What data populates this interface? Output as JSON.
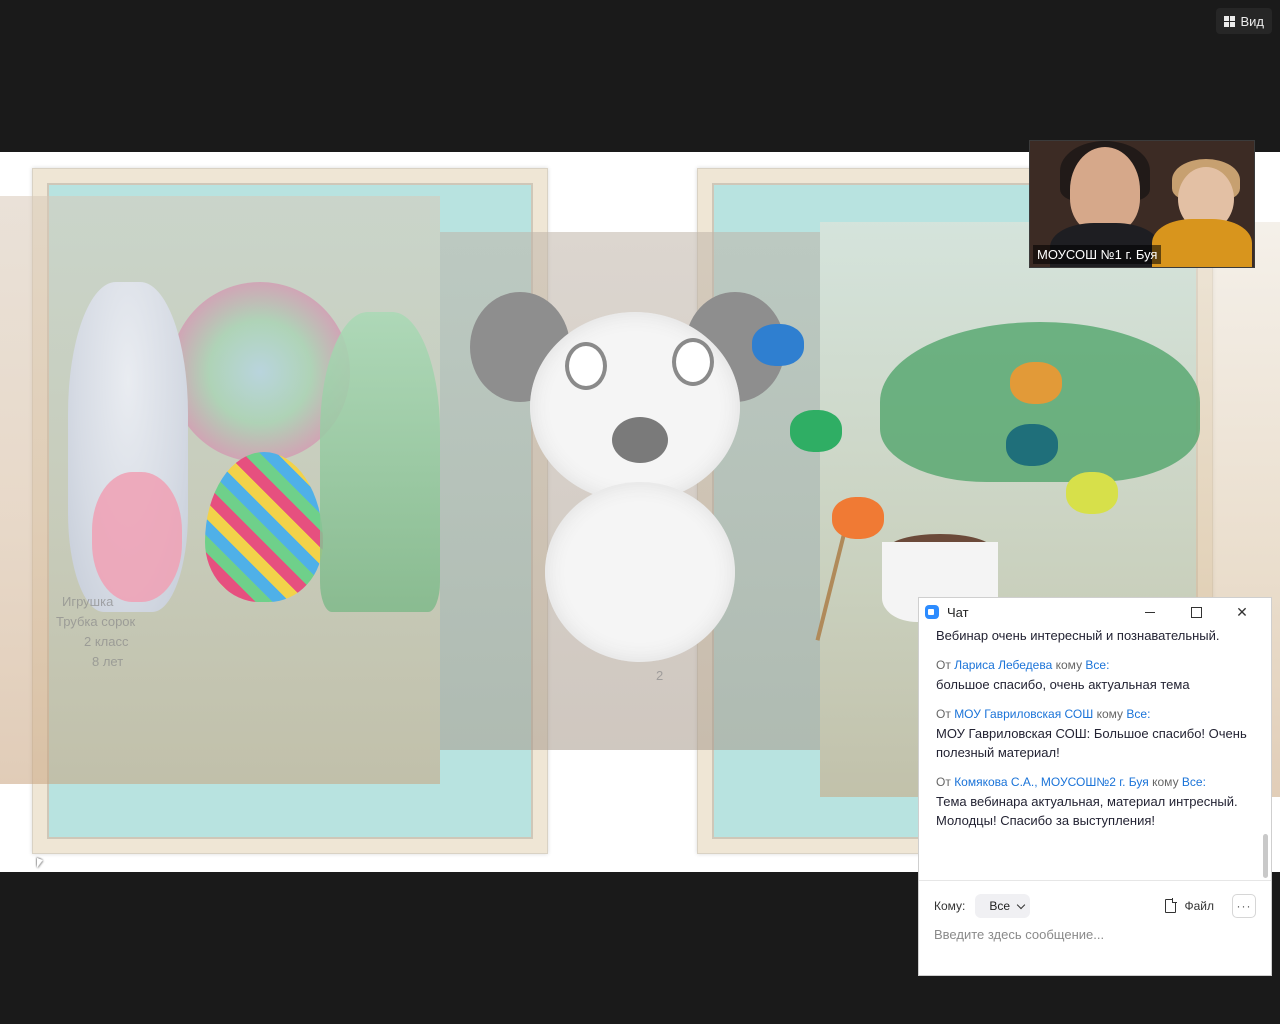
{
  "toolbar": {
    "view_label": "Вид",
    "view_icon": "grid-icon"
  },
  "shared_screen": {
    "captions": {
      "left_line1": "Игрушка",
      "left_line2": "Трубка сорок",
      "left_line3": "2 класс",
      "left_line4": "8 лет",
      "mid_number": "2"
    }
  },
  "participant": {
    "name": "МОУСОШ №1 г. Буя"
  },
  "chat": {
    "title": "Чат",
    "messages": [
      {
        "from": "",
        "to": "",
        "text": "Вебинар очень интересный и познавательный."
      },
      {
        "prefix": "От",
        "from": "Лариса Лебедева",
        "middle": "кому",
        "to": "Все:",
        "text": "большое спасибо, очень актуальная тема"
      },
      {
        "prefix": "От",
        "from": "МОУ Гавриловская СОШ",
        "middle": "кому",
        "to": "Все:",
        "text": "МОУ Гавриловская СОШ: Большое спасибо! Очень полезный материал!"
      },
      {
        "prefix": "От",
        "from": "Комякова С.А., МОУСОШ№2 г. Буя",
        "middle": "кому",
        "to": "Все:",
        "text": "Тема вебинара актуальная, материал интресный. Молодцы! Спасибо за выступления!"
      }
    ],
    "to_label": "Кому:",
    "to_value": "Все",
    "file_label": "Файл",
    "more_label": "···",
    "input_placeholder": "Введите здесь сообщение...",
    "accent_color": "#2d8cff"
  }
}
